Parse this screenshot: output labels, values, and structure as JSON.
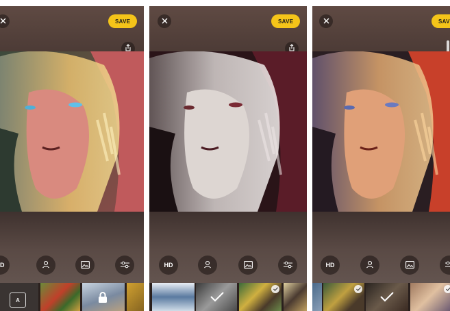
{
  "screens": [
    {
      "id": "screen-1",
      "close_icon": "close-icon",
      "save_label": "SAVE",
      "share_icon": "share-icon",
      "toolbar": {
        "hd_label": "HD"
      },
      "strip": {
        "filter_a_label": "A"
      }
    },
    {
      "id": "screen-2",
      "close_icon": "close-icon",
      "save_label": "SAVE",
      "share_icon": "share-icon",
      "toolbar": {
        "hd_label": "HD"
      }
    },
    {
      "id": "screen-3",
      "close_icon": "close-icon",
      "save_label": "SAV",
      "share_icon": "share-icon",
      "toolbar": {
        "hd_label": "HD"
      }
    }
  ],
  "colors": {
    "save_button": "#f4c419",
    "toolbar_button": "#1f1714"
  },
  "icons": [
    "close-icon",
    "share-icon",
    "portrait-icon",
    "image-icon",
    "sliders-icon",
    "lock-icon",
    "check-icon"
  ]
}
